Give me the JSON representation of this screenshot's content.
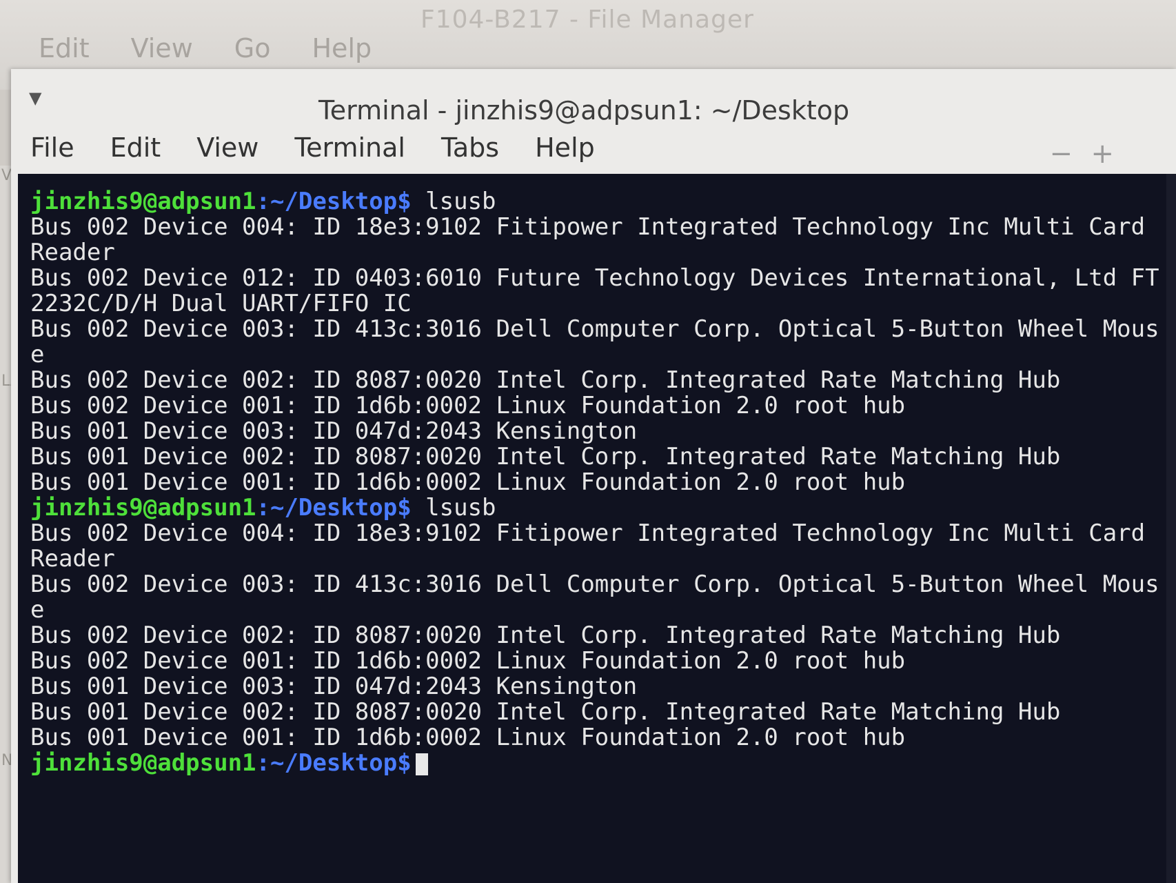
{
  "file_manager": {
    "title": "F104-B217 - File Manager",
    "menu": [
      "Edit",
      "View",
      "Go",
      "Help"
    ]
  },
  "terminal": {
    "title": "Terminal - jinzhis9@adpsun1: ~/Desktop",
    "menu": [
      "File",
      "Edit",
      "View",
      "Terminal",
      "Tabs",
      "Help"
    ],
    "min_icon": "minimize-icon",
    "max_icon": "maximize-icon",
    "colors": {
      "background": "#101220",
      "user": "#4ee03a",
      "path": "#4a7cff",
      "text": "#e6e6e6"
    },
    "lines": [
      {
        "type": "prompt",
        "user": "jinzhis9@adpsun1",
        "path": ":~/Desktop$",
        "cmd": " lsusb"
      },
      {
        "type": "out",
        "text": "Bus 002 Device 004: ID 18e3:9102 Fitipower Integrated Technology Inc Multi Card"
      },
      {
        "type": "out",
        "text": "Reader"
      },
      {
        "type": "out",
        "text": "Bus 002 Device 012: ID 0403:6010 Future Technology Devices International, Ltd FT"
      },
      {
        "type": "out",
        "text": "2232C/D/H Dual UART/FIFO IC"
      },
      {
        "type": "out",
        "text": "Bus 002 Device 003: ID 413c:3016 Dell Computer Corp. Optical 5-Button Wheel Mous"
      },
      {
        "type": "out",
        "text": "e"
      },
      {
        "type": "out",
        "text": "Bus 002 Device 002: ID 8087:0020 Intel Corp. Integrated Rate Matching Hub"
      },
      {
        "type": "out",
        "text": "Bus 002 Device 001: ID 1d6b:0002 Linux Foundation 2.0 root hub"
      },
      {
        "type": "out",
        "text": "Bus 001 Device 003: ID 047d:2043 Kensington"
      },
      {
        "type": "out",
        "text": "Bus 001 Device 002: ID 8087:0020 Intel Corp. Integrated Rate Matching Hub"
      },
      {
        "type": "out",
        "text": "Bus 001 Device 001: ID 1d6b:0002 Linux Foundation 2.0 root hub"
      },
      {
        "type": "prompt",
        "user": "jinzhis9@adpsun1",
        "path": ":~/Desktop$",
        "cmd": " lsusb"
      },
      {
        "type": "out",
        "text": "Bus 002 Device 004: ID 18e3:9102 Fitipower Integrated Technology Inc Multi Card"
      },
      {
        "type": "out",
        "text": "Reader"
      },
      {
        "type": "out",
        "text": "Bus 002 Device 003: ID 413c:3016 Dell Computer Corp. Optical 5-Button Wheel Mous"
      },
      {
        "type": "out",
        "text": "e"
      },
      {
        "type": "out",
        "text": "Bus 002 Device 002: ID 8087:0020 Intel Corp. Integrated Rate Matching Hub"
      },
      {
        "type": "out",
        "text": "Bus 002 Device 001: ID 1d6b:0002 Linux Foundation 2.0 root hub"
      },
      {
        "type": "out",
        "text": "Bus 001 Device 003: ID 047d:2043 Kensington"
      },
      {
        "type": "out",
        "text": "Bus 001 Device 002: ID 8087:0020 Intel Corp. Integrated Rate Matching Hub"
      },
      {
        "type": "out",
        "text": "Bus 001 Device 001: ID 1d6b:0002 Linux Foundation 2.0 root hub"
      },
      {
        "type": "prompt",
        "user": "jinzhis9@adpsun1",
        "path": ":~/Desktop$",
        "cmd": "",
        "cursor": true
      }
    ]
  },
  "sidebar": {
    "icons": [
      "home-icon",
      "desktop-icon",
      "trash-icon",
      "music-icon",
      "pictures-icon",
      "documents-icon",
      "network-icon",
      "wifi-icon"
    ],
    "labels": [
      "V",
      "LA",
      "NE"
    ]
  }
}
